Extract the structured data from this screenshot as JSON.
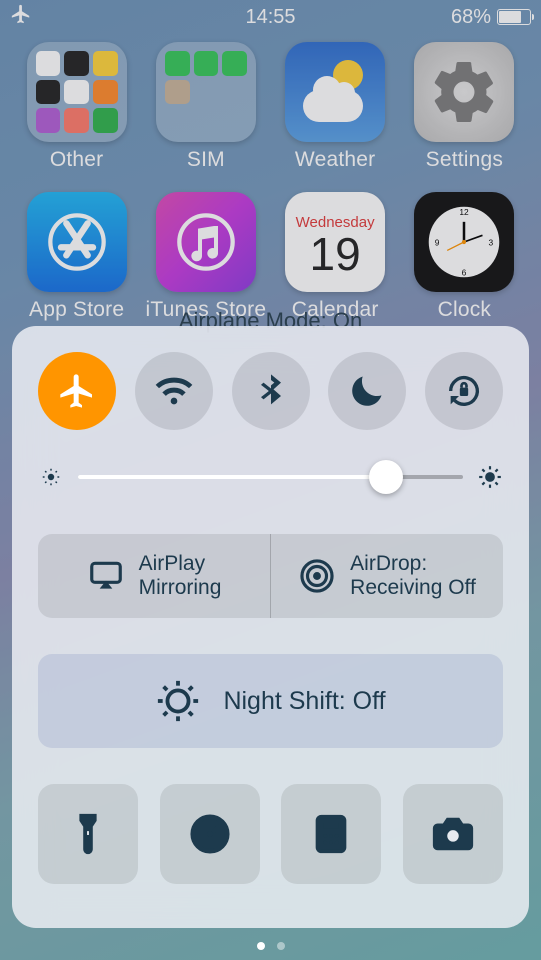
{
  "status": {
    "time": "14:55",
    "battery_percent": "68%"
  },
  "home": {
    "apps": [
      {
        "label": "Other"
      },
      {
        "label": "SIM"
      },
      {
        "label": "Weather"
      },
      {
        "label": "Settings"
      },
      {
        "label": "App Store"
      },
      {
        "label": "iTunes Store"
      },
      {
        "label": "Calendar",
        "weekday": "Wednesday",
        "day": "19"
      },
      {
        "label": "Clock"
      }
    ],
    "status_overlay": "Airplane Mode: On"
  },
  "control_center": {
    "toggles": {
      "airplane": {
        "on": true
      },
      "wifi": {
        "on": false
      },
      "bluetooth": {
        "on": false
      },
      "dnd": {
        "on": false
      },
      "orientation_lock": {
        "on": false
      }
    },
    "brightness": {
      "value_percent": 80
    },
    "airplay_label_line1": "AirPlay",
    "airplay_label_line2": "Mirroring",
    "airdrop_label_line1": "AirDrop:",
    "airdrop_label_line2": "Receiving Off",
    "night_shift_label": "Night Shift: Off",
    "pages": {
      "count": 2,
      "active": 0
    }
  }
}
